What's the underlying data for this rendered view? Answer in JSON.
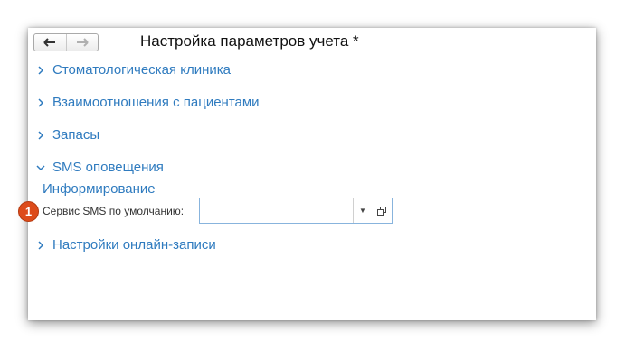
{
  "title": "Настройка параметров учета *",
  "nav": {
    "back_icon": "arrow-left-icon",
    "forward_icon": "arrow-right-icon"
  },
  "sections": [
    {
      "label": "Стоматологическая клиника",
      "expanded": false
    },
    {
      "label": "Взаимоотношения с пациентами",
      "expanded": false
    },
    {
      "label": "Запасы",
      "expanded": false
    },
    {
      "label": "SMS оповещения",
      "expanded": true
    },
    {
      "label": "Настройки онлайн-записи",
      "expanded": false
    }
  ],
  "sms": {
    "group_title": "Информирование",
    "field_label": "Сервис SMS по умолчанию:",
    "field_value": "",
    "badge": "1"
  },
  "colors": {
    "link": "#2f7bbf",
    "badge": "#dd4b1a",
    "field_border": "#88b4dd"
  }
}
